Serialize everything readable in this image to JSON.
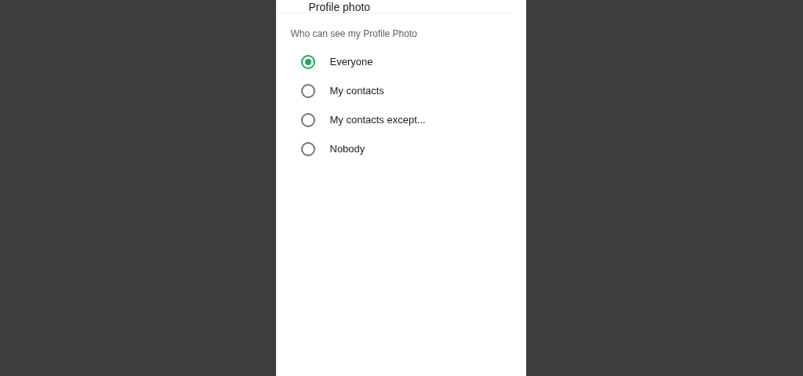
{
  "header": {
    "title": "Profile photo"
  },
  "section": {
    "label": "Who can see my Profile Photo"
  },
  "options": [
    {
      "label": "Everyone",
      "selected": true
    },
    {
      "label": "My contacts",
      "selected": false
    },
    {
      "label": "My contacts except...",
      "selected": false
    },
    {
      "label": "Nobody",
      "selected": false
    }
  ]
}
